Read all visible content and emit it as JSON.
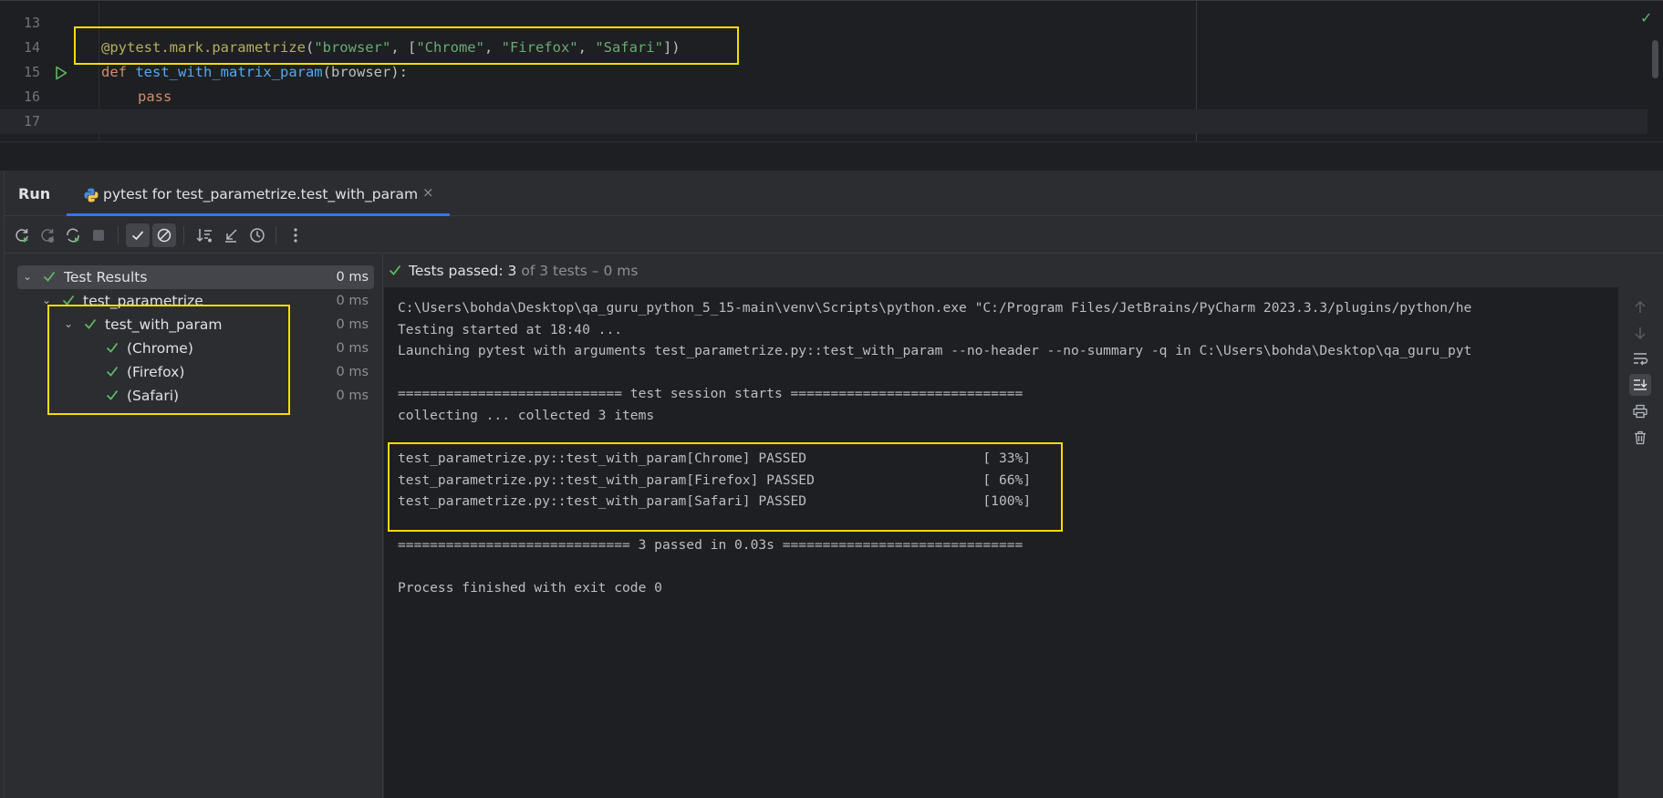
{
  "colors": {
    "accent": "#3574f0",
    "passed": "#5fb865",
    "highlight_box": "#f5dd00"
  },
  "editor": {
    "lines": [
      {
        "number": "13"
      },
      {
        "number": "14",
        "decorator": "@pytest.mark.parametrize",
        "p1": "(",
        "s1": "\"browser\"",
        "p2": ", [",
        "s2": "\"Chrome\"",
        "p3": ", ",
        "s3": "\"Firefox\"",
        "p4": ", ",
        "s4": "\"Safari\"",
        "p5": "])"
      },
      {
        "number": "15",
        "keyword": "def",
        "function": "test_with_matrix_param",
        "params": "(browser):"
      },
      {
        "number": "16",
        "keyword": "pass"
      },
      {
        "number": "17"
      }
    ],
    "gutter_icon": "run-test-icon",
    "status_icon": "check-icon"
  },
  "run": {
    "title": "Run",
    "tab": {
      "label": "pytest for test_parametrize.test_with_param",
      "icon": "python-icon",
      "close": "×"
    },
    "toolbar": [
      "rerun-icon",
      "rerun-failed-icon",
      "toggle-auto-test-icon",
      "stop-icon",
      "show-passed-icon",
      "show-ignored-icon",
      "sort-icon",
      "collapse-all-icon",
      "history-icon",
      "more-icon"
    ],
    "tree": [
      {
        "label": "Test Results",
        "time": "0 ms"
      },
      {
        "label": "test_parametrize",
        "time": "0 ms"
      },
      {
        "label": "test_with_param",
        "time": "0 ms"
      },
      {
        "label": "(Chrome)",
        "time": "0 ms"
      },
      {
        "label": "(Firefox)",
        "time": "0 ms"
      },
      {
        "label": "(Safari)",
        "time": "0 ms"
      }
    ],
    "status": {
      "passed_label": "Tests passed: 3",
      "rest": "of 3 tests – 0 ms"
    },
    "console": [
      "C:\\Users\\bohda\\Desktop\\qa_guru_python_5_15-main\\venv\\Scripts\\python.exe \"C:/Program Files/JetBrains/PyCharm 2023.3.3/plugins/python/he",
      "Testing started at 18:40 ...",
      "Launching pytest with arguments test_parametrize.py::test_with_param --no-header --no-summary -q in C:\\Users\\bohda\\Desktop\\qa_guru_pyt",
      "",
      "============================ test session starts =============================",
      "collecting ... collected 3 items",
      "",
      "test_parametrize.py::test_with_param[Chrome] PASSED                      [ 33%]",
      "test_parametrize.py::test_with_param[Firefox] PASSED                     [ 66%]",
      "test_parametrize.py::test_with_param[Safari] PASSED                      [100%]",
      "",
      "============================= 3 passed in 0.03s ==============================",
      "",
      "Process finished with exit code 0"
    ],
    "side_buttons": [
      "arrow-up-icon",
      "arrow-down-icon",
      "soft-wrap-icon",
      "scroll-to-end-icon",
      "print-icon",
      "clear-icon"
    ]
  }
}
